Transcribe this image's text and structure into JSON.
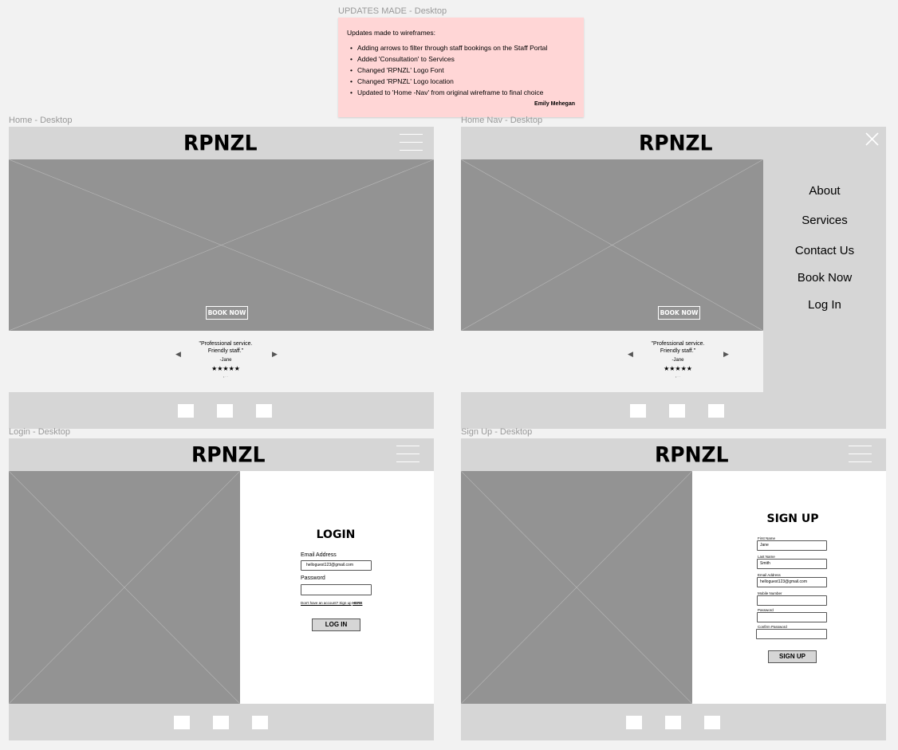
{
  "updates_frame": {
    "label": "UPDATES MADE - Desktop",
    "title": "Updates made to wireframes:",
    "items": [
      "Adding arrows to filter through staff bookings on the Staff Portal",
      "Added 'Consultation' to Services",
      "Changed 'RPNZL' Logo Font",
      "Changed 'RPNZL' Logo location",
      "Updated to 'Home -Nav' from original wireframe to final choice"
    ],
    "signature": "Emily Mehegan",
    "color": "#ffd6d6"
  },
  "home": {
    "label": "Home - Desktop",
    "logo": "RPNZL",
    "book_now": "BOOK NOW",
    "testimonial": {
      "quote_line1": "\"Professional service.",
      "quote_line2": "Friendly staff.\"",
      "author": "-Jane",
      "stars": "★★★★★",
      "dots": "• · ·",
      "prev_icon": "left-triangle-icon",
      "next_icon": "right-triangle-icon"
    }
  },
  "home_nav": {
    "label": "Home Nav - Desktop",
    "logo": "RPNZL",
    "book_now": "BOOK NOW",
    "close_icon": "close-icon",
    "menu": [
      "About",
      "Services",
      "Contact Us",
      "Book Now",
      "Log In"
    ],
    "testimonial": {
      "quote_line1": "\"Professional service.",
      "quote_line2": "Friendly staff.\"",
      "author": "-Jane",
      "stars": "★★★★★",
      "dots": "• · ·"
    }
  },
  "login": {
    "label": "Login - Desktop",
    "logo": "RPNZL",
    "title": "LOGIN",
    "email_label": "Email Address",
    "email_value": "helloguest123@gmail.com",
    "password_label": "Password",
    "password_value": "",
    "signup_prompt": "Don't have an account? Sign up",
    "signup_link": "HERE",
    "button": "LOG IN"
  },
  "signup": {
    "label": "Sign Up - Desktop",
    "logo": "RPNZL",
    "title": "SIGN UP",
    "first_name_label": "First Name",
    "first_name_value": "Jane",
    "last_name_label": "Last Name",
    "last_name_value": "Smith",
    "email_label": "Email Address",
    "email_value": "helloguest123@gmail.com",
    "mobile_label": "Mobile Number",
    "mobile_value": "",
    "password_label": "Password",
    "password_value": "",
    "confirm_label": "Confirm Password",
    "confirm_value": "",
    "button": "SIGN UP"
  },
  "colors": {
    "canvas": "#f2f2f2",
    "header": "#d6d6d6",
    "image_placeholder": "#939393"
  }
}
